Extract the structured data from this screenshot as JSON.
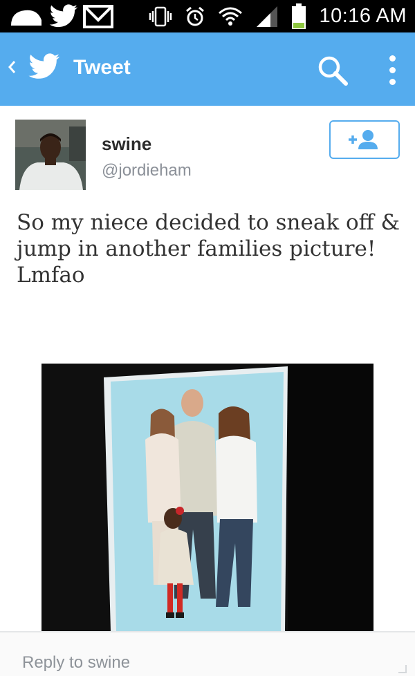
{
  "status_bar": {
    "time": "10:16 AM",
    "left_icons": [
      "cloud-icon",
      "twitter-notification-icon",
      "gmail-icon"
    ],
    "right_icons": [
      "vibrate-icon",
      "alarm-icon",
      "wifi-icon",
      "signal-icon",
      "battery-icon"
    ],
    "battery_level": 0.25
  },
  "action_bar": {
    "title": "Tweet",
    "color": "#55acee",
    "icons": [
      "back-chevron-icon",
      "twitter-bird-icon",
      "search-icon",
      "overflow-menu-icon"
    ]
  },
  "tweet": {
    "author_name": "swine",
    "author_handle": "@jordieham",
    "text": "So my niece decided to sneak off & jump in another families picture! Lmfao",
    "follow_icon": "add-user-icon"
  },
  "reply": {
    "placeholder": "Reply to swine"
  }
}
